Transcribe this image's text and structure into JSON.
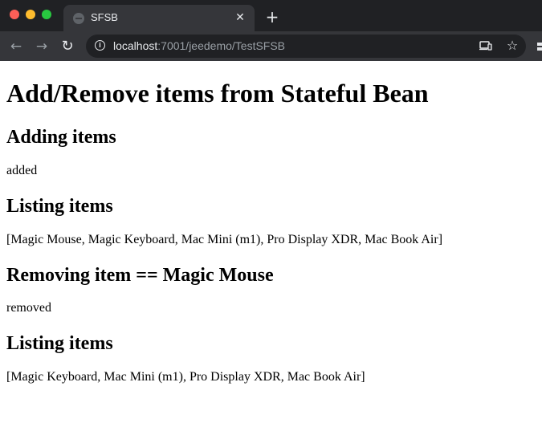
{
  "browser": {
    "tab": {
      "title": "SFSB",
      "close_glyph": "✕"
    },
    "new_tab_glyph": "+",
    "address_bar": {
      "host": "localhost",
      "rest": ":7001/jeedemo/TestSFSB"
    },
    "icons": {
      "back": "back-arrow-icon",
      "forward": "forward-arrow-icon",
      "reload": "reload-icon",
      "site_info": "info-icon",
      "cast": "cast-icon",
      "bookmark": "star-icon"
    },
    "colors": {
      "close_button": "#ff5f57",
      "minimize_button": "#febc2e",
      "zoom_button": "#28c840",
      "titlebar": "#202124",
      "toolbar": "#35363a"
    }
  },
  "page": {
    "heading": "Add/Remove items from Stateful Bean",
    "sections": [
      {
        "title": "Adding items",
        "text": "added"
      },
      {
        "title": "Listing items",
        "text": "[Magic Mouse, Magic Keyboard, Mac Mini (m1), Pro Display XDR, Mac Book Air]"
      },
      {
        "title": "Removing item == Magic Mouse",
        "text": "removed"
      },
      {
        "title": "Listing items",
        "text": "[Magic Keyboard, Mac Mini (m1), Pro Display XDR, Mac Book Air]"
      }
    ]
  }
}
